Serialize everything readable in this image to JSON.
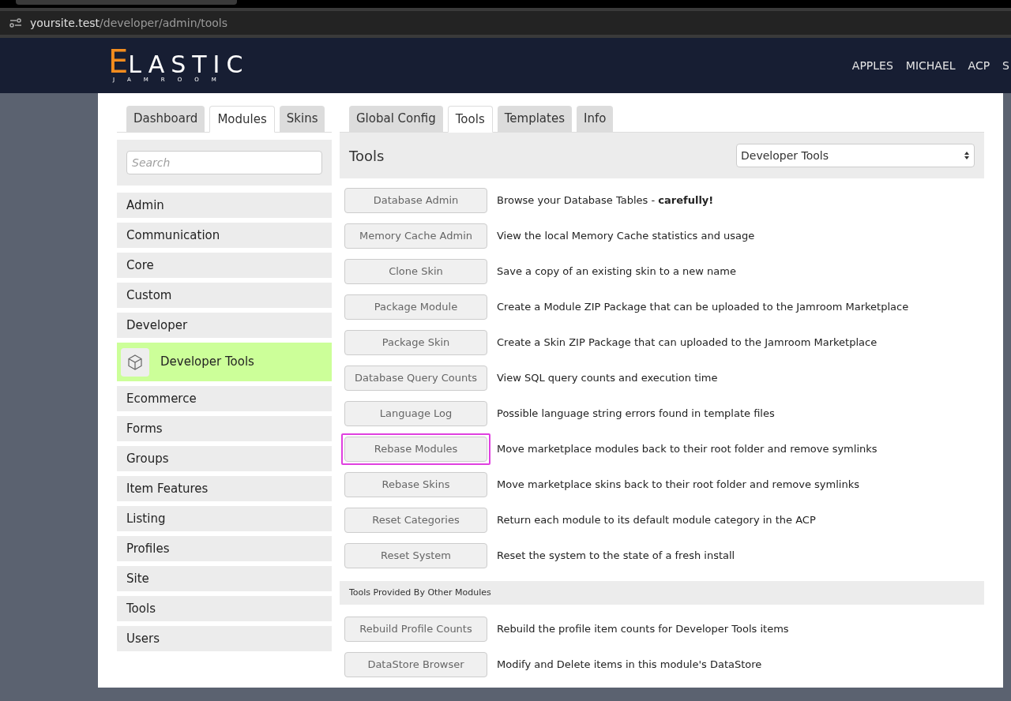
{
  "browser": {
    "url_host": "yoursite.test",
    "url_path": "/developer/admin/tools"
  },
  "header": {
    "logo_initial": "E",
    "logo_rest": "LASTIC",
    "logo_sub": "JAMROOM",
    "nav": [
      "APPLES",
      "MICHAEL",
      "ACP",
      "S"
    ]
  },
  "left_tabs": [
    {
      "label": "Dashboard",
      "selected": false
    },
    {
      "label": "Modules",
      "selected": true
    },
    {
      "label": "Skins",
      "selected": false
    }
  ],
  "right_tabs": [
    {
      "label": "Global Config",
      "selected": false
    },
    {
      "label": "Tools",
      "selected": true
    },
    {
      "label": "Templates",
      "selected": false
    },
    {
      "label": "Info",
      "selected": false
    }
  ],
  "sidebar": {
    "search": {
      "placeholder": "Search"
    },
    "items": [
      {
        "label": "Admin",
        "selected": false
      },
      {
        "label": "Communication",
        "selected": false
      },
      {
        "label": "Core",
        "selected": false
      },
      {
        "label": "Custom",
        "selected": false
      },
      {
        "label": "Developer",
        "selected": false
      },
      {
        "label": "Developer Tools",
        "selected": true
      },
      {
        "label": "Ecommerce",
        "selected": false
      },
      {
        "label": "Forms",
        "selected": false
      },
      {
        "label": "Groups",
        "selected": false
      },
      {
        "label": "Item Features",
        "selected": false
      },
      {
        "label": "Listing",
        "selected": false
      },
      {
        "label": "Profiles",
        "selected": false
      },
      {
        "label": "Site",
        "selected": false
      },
      {
        "label": "Tools",
        "selected": false
      },
      {
        "label": "Users",
        "selected": false
      }
    ]
  },
  "panel": {
    "title": "Tools",
    "dropdown": "Developer Tools",
    "tools": [
      {
        "button": "Database Admin",
        "description": "Browse your Database Tables - **carefully!**",
        "highlighted": false
      },
      {
        "button": "Memory Cache Admin",
        "description": "View the local Memory Cache statistics and usage",
        "highlighted": false
      },
      {
        "button": "Clone Skin",
        "description": "Save a copy of an existing skin to a new name",
        "highlighted": false
      },
      {
        "button": "Package Module",
        "description": "Create a Module ZIP Package that can be uploaded to the Jamroom Marketplace",
        "highlighted": false
      },
      {
        "button": "Package Skin",
        "description": "Create a Skin ZIP Package that can uploaded to the Jamroom Marketplace",
        "highlighted": false
      },
      {
        "button": "Database Query Counts",
        "description": "View SQL query counts and execution time",
        "highlighted": false
      },
      {
        "button": "Language Log",
        "description": "Possible language string errors found in template files",
        "highlighted": false
      },
      {
        "button": "Rebase Modules",
        "description": "Move marketplace modules back to their root folder and remove symlinks",
        "highlighted": true
      },
      {
        "button": "Rebase Skins",
        "description": "Move marketplace skins back to their root folder and remove symlinks",
        "highlighted": false
      },
      {
        "button": "Reset Categories",
        "description": "Return each module to its default module category in the ACP",
        "highlighted": false
      },
      {
        "button": "Reset System",
        "description": "Reset the system to the state of a fresh install",
        "highlighted": false
      }
    ],
    "other_heading": "Tools Provided By Other Modules",
    "other_tools": [
      {
        "button": "Rebuild Profile Counts",
        "description": "Rebuild the profile item counts for Developer Tools items",
        "highlighted": false
      },
      {
        "button": "DataStore Browser",
        "description": "Modify and Delete items in this module's DataStore",
        "highlighted": false
      }
    ]
  }
}
